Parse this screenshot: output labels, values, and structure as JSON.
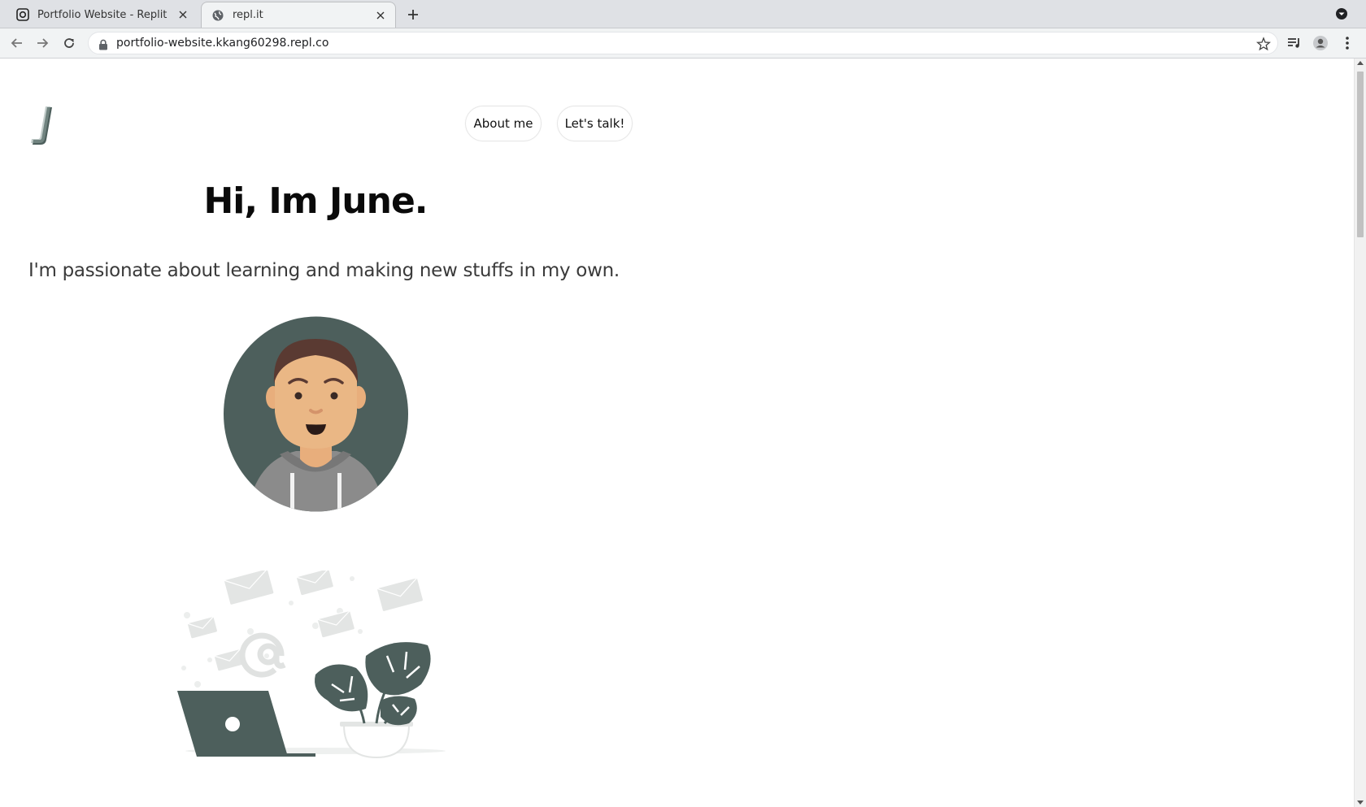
{
  "browser": {
    "tabs": [
      {
        "title": "Portfolio Website - Replit",
        "icon": "replit-icon",
        "active": false
      },
      {
        "title": "repl.it",
        "icon": "globe-icon",
        "active": true
      }
    ],
    "url": "portfolio-website.kkang60298.repl.co"
  },
  "page": {
    "logo_text": "J",
    "nav": {
      "about_label": "About me",
      "talk_label": "Let's talk!"
    },
    "hero": {
      "title": "Hi, Im June.",
      "subtitle": "I'm passionate about learning and making new stuffs in my own."
    }
  },
  "colors": {
    "accent": "#4d5f5c",
    "skin": "#eab785",
    "hoodie": "#8b8b8b",
    "hair": "#5a3a32"
  }
}
